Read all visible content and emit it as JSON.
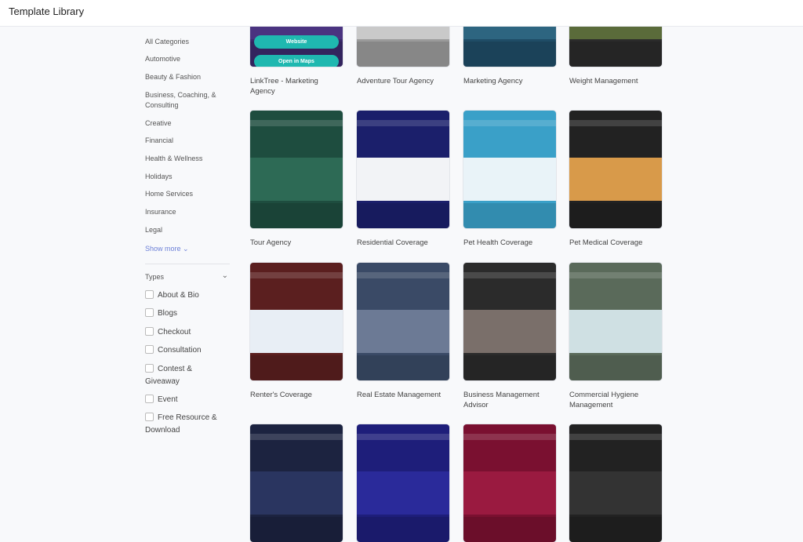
{
  "header": {
    "title": "Template Library"
  },
  "categories": [
    "All Categories",
    "Automotive",
    "Beauty & Fashion",
    "Business, Coaching, & Consulting",
    "Creative",
    "Financial",
    "Health & Wellness",
    "Holidays",
    "Home Services",
    "Insurance",
    "Legal"
  ],
  "show_more": "Show more",
  "types": {
    "title": "Types",
    "items": [
      "About & Bio",
      "Blogs",
      "Checkout",
      "Consultation",
      "Contest & Giveaway",
      "Event",
      "Free Resource & Download"
    ]
  },
  "thumb_text": {
    "website": "Website",
    "maps": "Open in Maps"
  },
  "templates": [
    {
      "name": "LinkTree - Marketing Agency",
      "colors": [
        "#3b2a6b",
        "#4a3380"
      ]
    },
    {
      "name": "Adventure Tour Agency",
      "colors": [
        "#9a9a9a",
        "#c9c9c9"
      ]
    },
    {
      "name": "Marketing Agency",
      "colors": [
        "#1f4c66",
        "#2d6580"
      ]
    },
    {
      "name": "Weight Management",
      "colors": [
        "#2b2b2b",
        "#5a6b3a"
      ]
    },
    {
      "name": "Tour Agency",
      "colors": [
        "#1e4d3f",
        "#2d6a55"
      ]
    },
    {
      "name": "Residential Coverage",
      "colors": [
        "#1b1f6b",
        "#f2f3f6"
      ]
    },
    {
      "name": "Pet Health Coverage",
      "colors": [
        "#3aa0c8",
        "#e9f3f8"
      ]
    },
    {
      "name": "Pet Medical Coverage",
      "colors": [
        "#222",
        "#d89a4a"
      ]
    },
    {
      "name": "Renter's Coverage",
      "colors": [
        "#5b1f1f",
        "#e8eef5"
      ]
    },
    {
      "name": "Real Estate Management",
      "colors": [
        "#3a4a66",
        "#6c7a95"
      ]
    },
    {
      "name": "Business Management Advisor",
      "colors": [
        "#2b2b2b",
        "#7a6f6a"
      ]
    },
    {
      "name": "Commercial Hygiene Management",
      "colors": [
        "#5a6a5a",
        "#cfe0e3"
      ]
    },
    {
      "name": "",
      "colors": [
        "#1c2340",
        "#2a3560"
      ]
    },
    {
      "name": "",
      "colors": [
        "#1e1e7a",
        "#2a2a9a"
      ]
    },
    {
      "name": "",
      "colors": [
        "#7a1030",
        "#9a1a40"
      ]
    },
    {
      "name": "",
      "colors": [
        "#222",
        "#333"
      ]
    }
  ]
}
